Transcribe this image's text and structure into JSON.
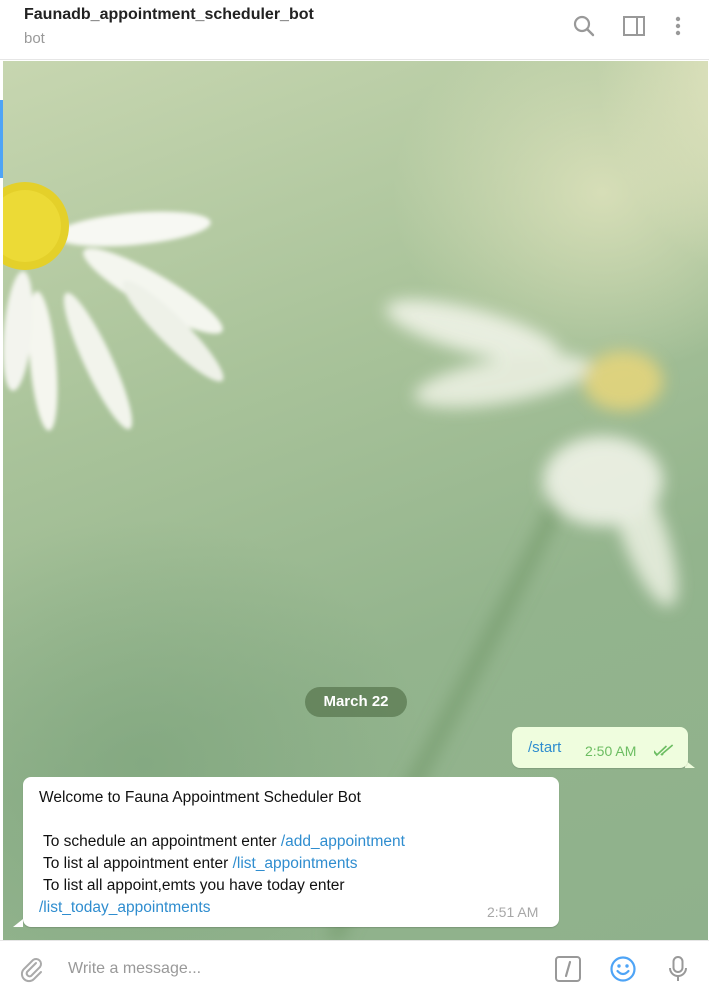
{
  "header": {
    "title": "Faunadb_appointment_scheduler_bot",
    "subtitle": "bot",
    "icons": [
      "search-icon",
      "sidebar-toggle-icon",
      "more-vertical-icon"
    ]
  },
  "chat": {
    "date_separator": "March 22",
    "outgoing": {
      "text": "/start",
      "time": "2:50 AM",
      "status_icon": "double-check-icon"
    },
    "incoming": {
      "line1": "Welcome to Fauna Appointment Scheduler Bot",
      "line2_text": "To schedule an appointment enter ",
      "line2_cmd": "/add_appointment",
      "line3_text": "To list al appointment enter ",
      "line3_cmd": "/list_appointments",
      "line4_text": "To list all appoint,emts you have today enter",
      "line5_cmd": "/list_today_appointments",
      "time": "2:51 AM"
    }
  },
  "composer": {
    "placeholder": "Write a message...",
    "icons": [
      "attach-icon",
      "bot-command-icon",
      "emoji-icon",
      "microphone-icon"
    ]
  },
  "colors": {
    "link": "#2f8dcf",
    "outgoing_bubble": "#effdde",
    "outgoing_time": "#6cbd62",
    "accent": "#4ea4f6"
  }
}
